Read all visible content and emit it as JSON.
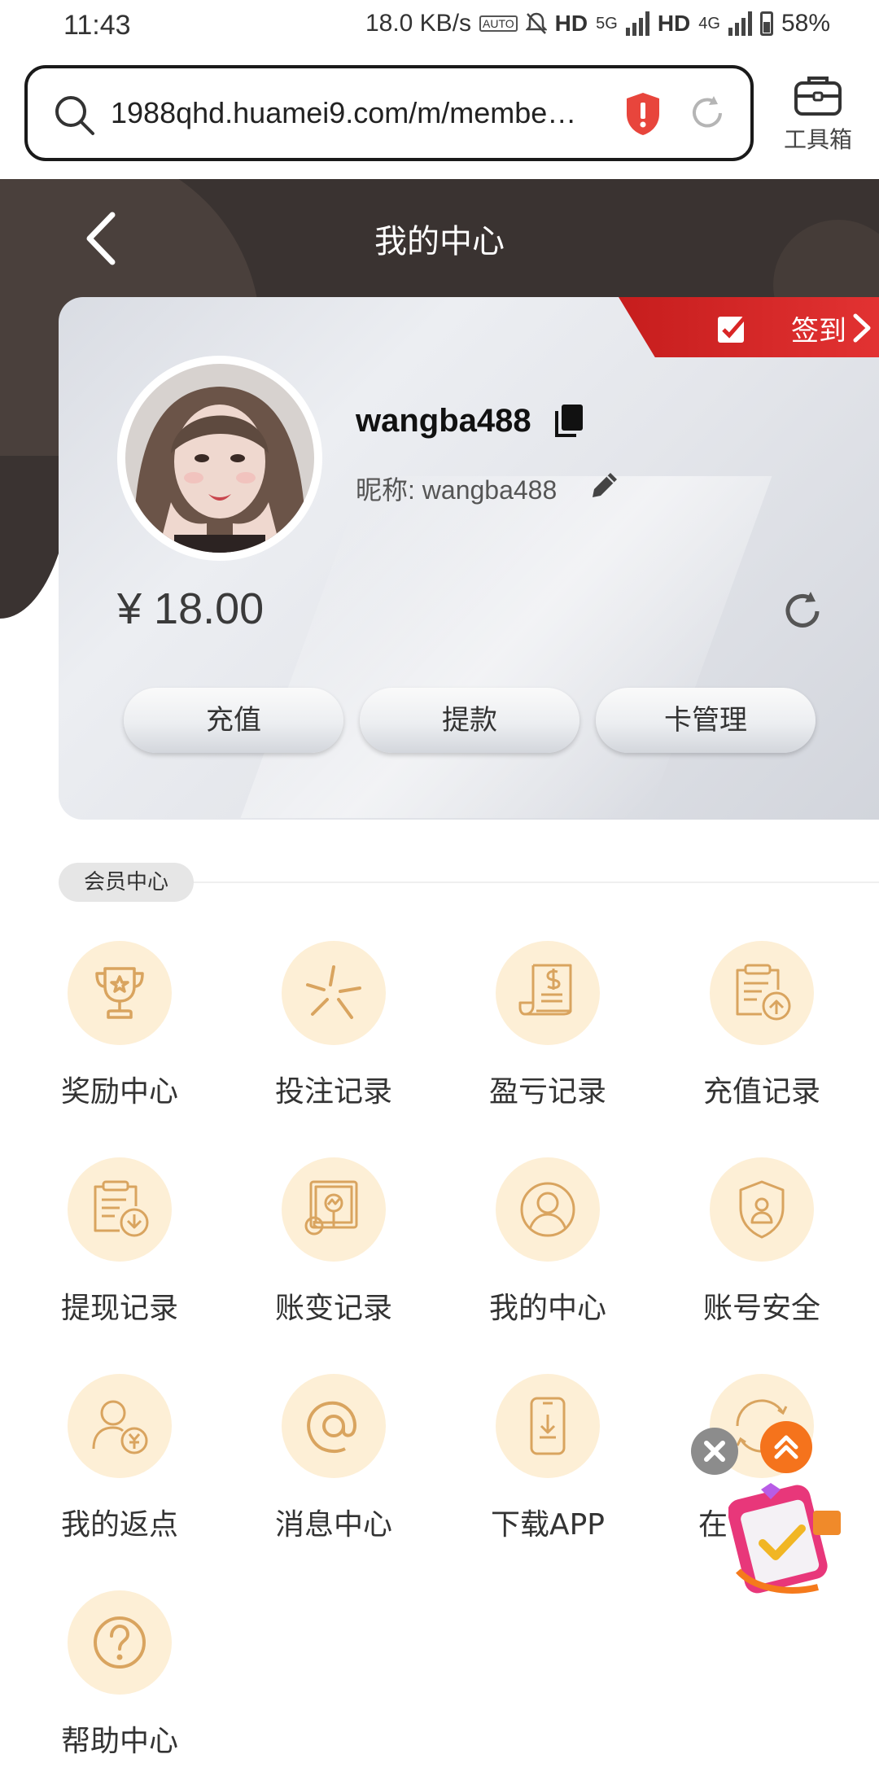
{
  "status_bar": {
    "time": "11:43",
    "net_speed": "18.0 KB/s",
    "auto_label": "AUTO",
    "hd1": "HD",
    "gen1": "5G",
    "hd2": "HD",
    "gen2": "4G",
    "battery": "58%"
  },
  "browser": {
    "url": "1988qhd.huamei9.com/m/membe…",
    "toolbox_label": "工具箱"
  },
  "header": {
    "title": "我的中心"
  },
  "profile": {
    "signin_label": "签到",
    "username": "wangba488",
    "nickname": "昵称: wangba488",
    "balance": "¥ 18.00",
    "buttons": [
      "充值",
      "提款",
      "卡管理"
    ]
  },
  "member_center": {
    "section_label": "会员中心",
    "items": [
      {
        "label": "奖励中心",
        "icon": "trophy-icon"
      },
      {
        "label": "投注记录",
        "icon": "star-burst-icon"
      },
      {
        "label": "盈亏记录",
        "icon": "receipt-dollar-icon"
      },
      {
        "label": "充值记录",
        "icon": "clipboard-upload-icon"
      },
      {
        "label": "提现记录",
        "icon": "clipboard-download-icon"
      },
      {
        "label": "账变记录",
        "icon": "chart-search-icon"
      },
      {
        "label": "我的中心",
        "icon": "user-circle-icon"
      },
      {
        "label": "账号安全",
        "icon": "shield-user-icon"
      },
      {
        "label": "我的返点",
        "icon": "user-yen-icon"
      },
      {
        "label": "消息中心",
        "icon": "at-sign-icon"
      },
      {
        "label": "下载APP",
        "icon": "phone-download-icon"
      },
      {
        "label": "在",
        "icon": "support-24-7-icon"
      },
      {
        "label": "帮助中心",
        "icon": "question-circle-icon"
      }
    ]
  },
  "colors": {
    "header_bg": "#3a3331",
    "accent_red": "#d92626",
    "icon_bg": "#fdefd6",
    "icon_stroke": "#d9a45f",
    "float_orange": "#f5731c"
  }
}
